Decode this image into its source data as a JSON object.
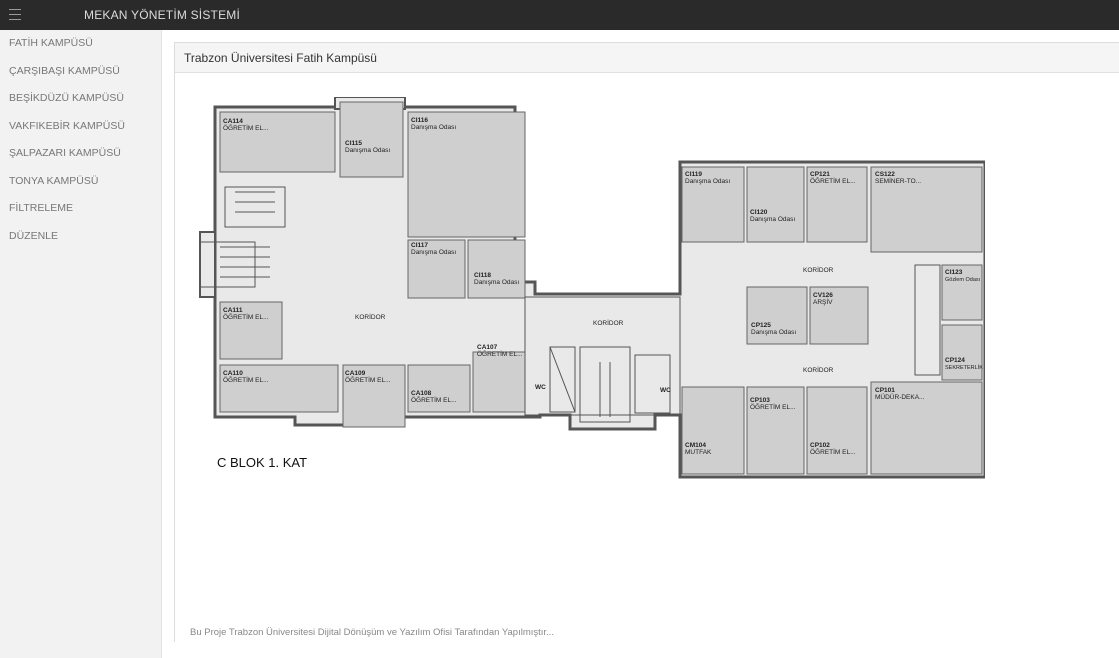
{
  "app": {
    "title": "MEKAN YÖNETİM SİSTEMİ"
  },
  "sidebar": {
    "items": [
      {
        "label": "FATİH KAMPÜSÜ"
      },
      {
        "label": "ÇARŞIBAŞI KAMPÜSÜ"
      },
      {
        "label": "BEŞİKDÜZÜ KAMPÜSÜ"
      },
      {
        "label": "VAKFIKEBİR KAMPÜSÜ"
      },
      {
        "label": "ŞALPAZARI KAMPÜSÜ"
      },
      {
        "label": "TONYA KAMPÜSÜ"
      },
      {
        "label": "FİLTRELEME"
      },
      {
        "label": "DÜZENLE"
      }
    ]
  },
  "panel": {
    "title": "Trabzon Üniversitesi Fatih Kampüsü"
  },
  "floorplan": {
    "floor_label": "C BLOK 1. KAT",
    "corridor_label": "KORİDOR",
    "wc_label": "WC",
    "rooms": [
      {
        "code": "CA114",
        "type": "ÖĞRETİM EL..."
      },
      {
        "code": "CI115",
        "type": "Danışma Odası"
      },
      {
        "code": "CI116",
        "type": "Danışma Odası"
      },
      {
        "code": "CI117",
        "type": "Danışma Odası"
      },
      {
        "code": "CI118",
        "type": "Danışma Odası"
      },
      {
        "code": "CA111",
        "type": "ÖĞRETİM EL..."
      },
      {
        "code": "CA110",
        "type": "ÖĞRETİM EL..."
      },
      {
        "code": "CA109",
        "type": "ÖĞRETİM EL..."
      },
      {
        "code": "CA108",
        "type": "ÖĞRETİM EL..."
      },
      {
        "code": "CA107",
        "type": "ÖĞRETİM EL..."
      },
      {
        "code": "CI119",
        "type": "Danışma Odası"
      },
      {
        "code": "CI120",
        "type": "Danışma Odası"
      },
      {
        "code": "CP121",
        "type": "ÖĞRETİM EL..."
      },
      {
        "code": "CS122",
        "type": "SEMİNER-TO..."
      },
      {
        "code": "CI123",
        "type": "Gözlem Odası"
      },
      {
        "code": "CV126",
        "type": "ARŞİV"
      },
      {
        "code": "CP125",
        "type": "Danışma Odası"
      },
      {
        "code": "CP124",
        "type": "SEKRETERLİK"
      },
      {
        "code": "CP101",
        "type": "MÜDÜR-DEKA..."
      },
      {
        "code": "CP103",
        "type": "ÖĞRETİM EL..."
      },
      {
        "code": "CM104",
        "type": "MUTFAK"
      },
      {
        "code": "CP102",
        "type": "ÖĞRETİM EL..."
      }
    ]
  },
  "footer": {
    "text": "Bu Proje Trabzon Üniversitesi Dijital Dönüşüm ve Yazılım Ofisi Tarafından Yapılmıştır..."
  }
}
